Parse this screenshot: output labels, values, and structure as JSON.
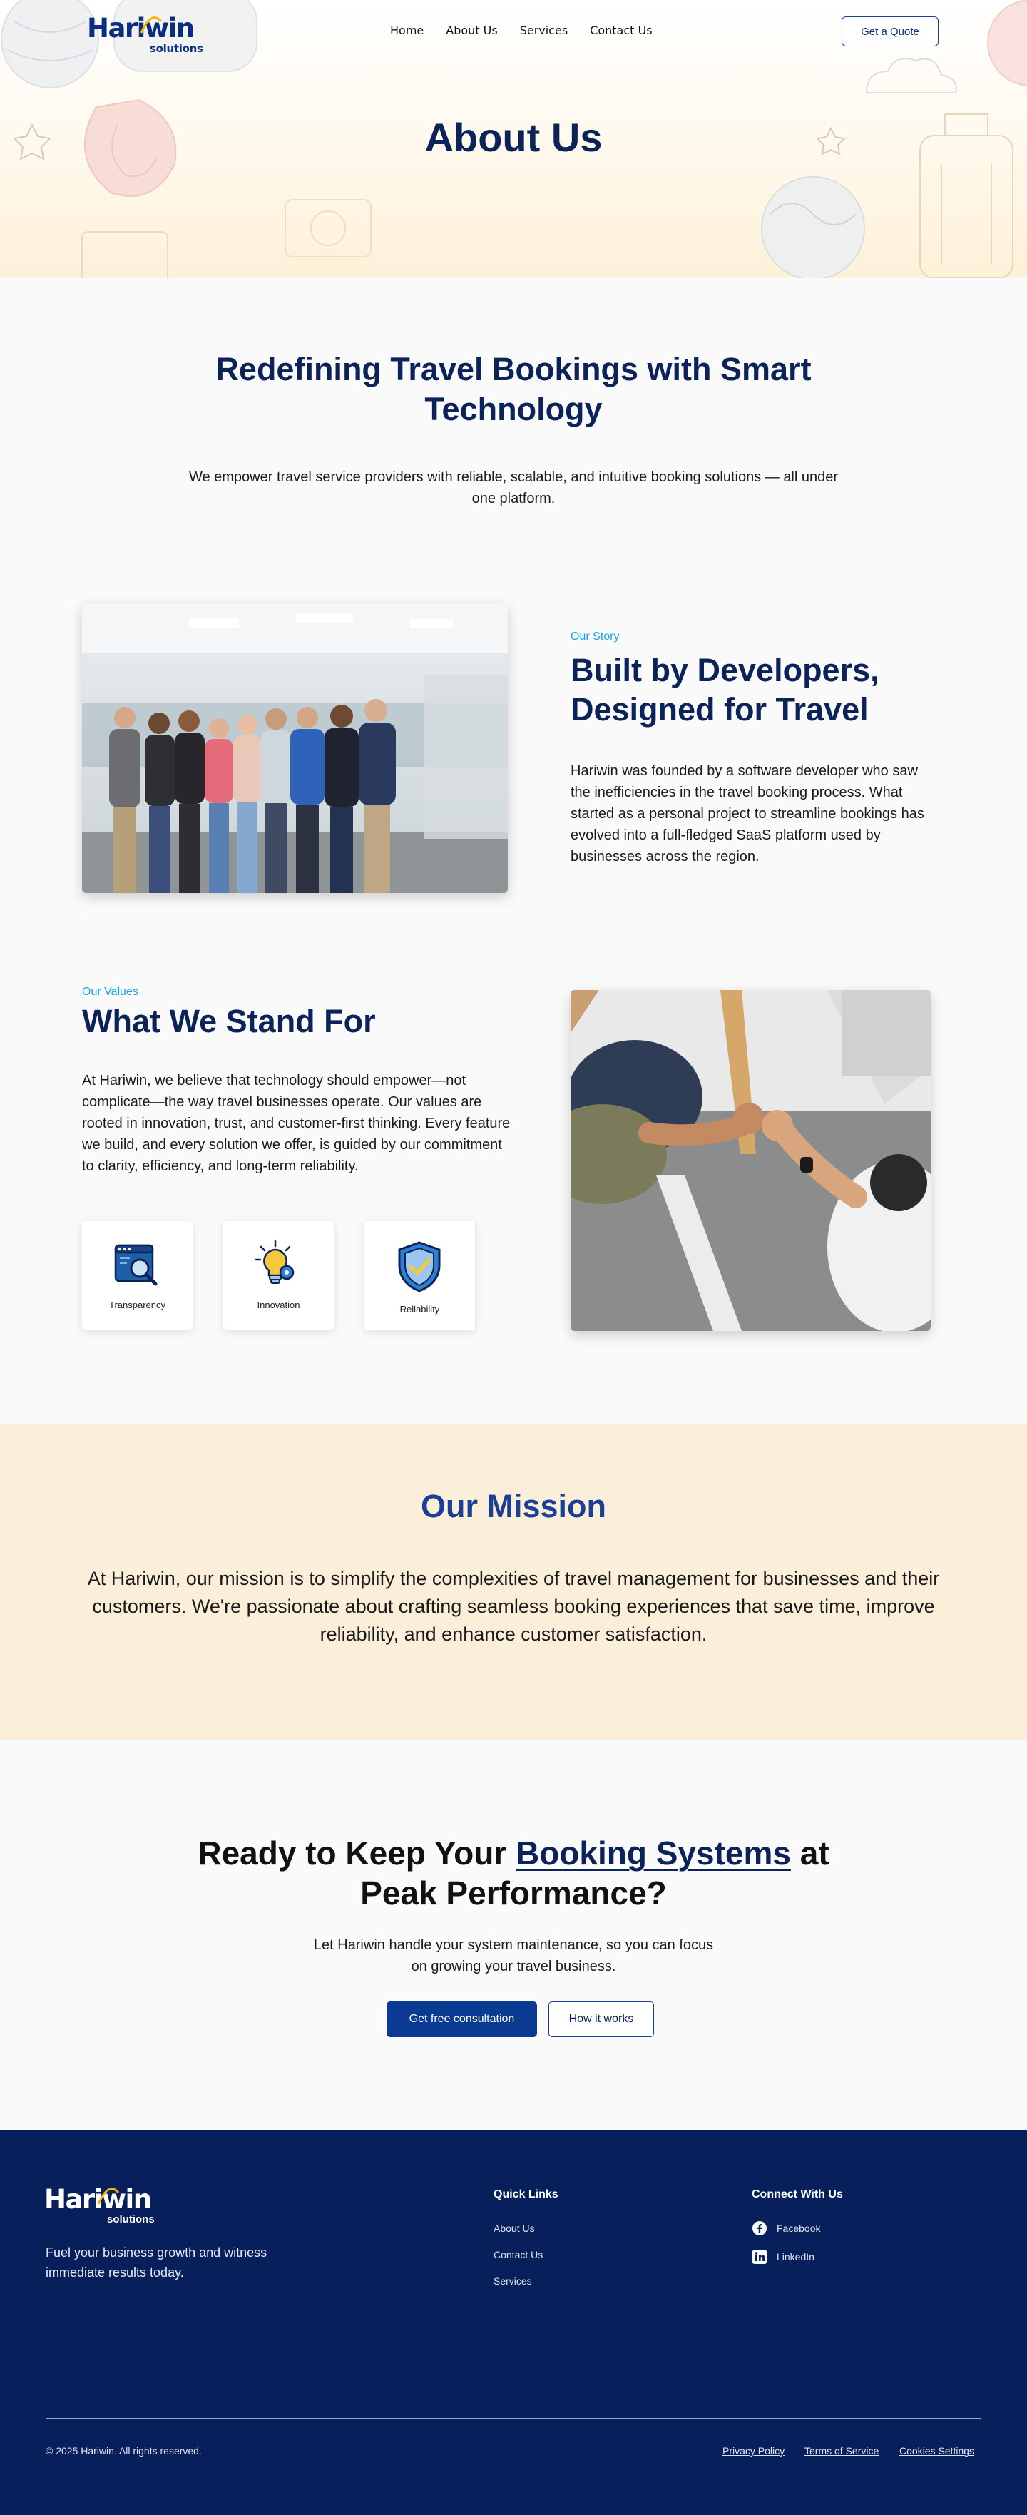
{
  "brand": {
    "logo_word": "Hariwin",
    "logo_sub": "solutions",
    "accent": "#0a2f80",
    "navy": "#0b2359",
    "sky": "#14a6e6",
    "cream": "#fbefd9",
    "footer_bg": "#071f5b"
  },
  "nav": {
    "links": [
      "Home",
      "About Us",
      "Services",
      "Contact Us"
    ],
    "cta_label": "Get a Quote"
  },
  "hero": {
    "title": "About Us"
  },
  "intro": {
    "heading": "Redefining Travel Bookings with Smart Technology",
    "text": "We empower travel service providers with reliable, scalable, and intuitive booking solutions — all under one platform."
  },
  "story": {
    "eyebrow": "Our Story",
    "title": "Built by Developers, Designed for Travel",
    "text": "Hariwin was founded by a software developer who saw the inefficiencies in the travel booking process. What started as a personal project to streamline bookings has evolved into a full-fledged SaaS platform used by businesses across the region.",
    "image_icon": "team-photo"
  },
  "values": {
    "eyebrow": "Our Values",
    "title": "What We Stand For",
    "text": "At Hariwin, we believe that technology should empower—not complicate—the way travel businesses operate. Our values are rooted in innovation, trust, and customer-first thinking. Every feature we build, and every solution we offer, is guided by our commitment to clarity, efficiency, and long-term reliability.",
    "cards": [
      {
        "label": "Transparency",
        "icon": "magnifier-window-icon"
      },
      {
        "label": "Innovation",
        "icon": "lightbulb-gear-icon"
      },
      {
        "label": "Reliability",
        "icon": "shield-check-icon"
      }
    ],
    "image_icon": "fist-bump-photo"
  },
  "mission": {
    "title": "Our Mission",
    "text": "At Hariwin, our mission is to simplify the complexities of travel management for businesses and their customers. We're passionate about crafting seamless booking experiences that save time, improve reliability, and enhance customer satisfaction."
  },
  "cta": {
    "title_before": "Ready to Keep Your ",
    "title_highlight": "Booking Systems",
    "title_after": " at Peak Performance?",
    "text": "Let Hariwin handle your system maintenance, so you can focus on growing your travel business.",
    "primary_label": "Get free consultation",
    "secondary_label": "How it works"
  },
  "footer": {
    "tagline": "Fuel your business growth and witness immediate results today.",
    "quick_links_heading": "Quick Links",
    "quick_links": [
      "About Us",
      "Contact Us",
      "Services"
    ],
    "connect_heading": "Connect With Us",
    "social": [
      {
        "label": "Facebook",
        "icon": "facebook-icon"
      },
      {
        "label": "LinkedIn",
        "icon": "linkedin-icon"
      }
    ],
    "copyright": "© 2025 Hariwin. All rights reserved.",
    "legal": [
      "Privacy Policy",
      "Terms of Service",
      "Cookies Settings"
    ]
  }
}
